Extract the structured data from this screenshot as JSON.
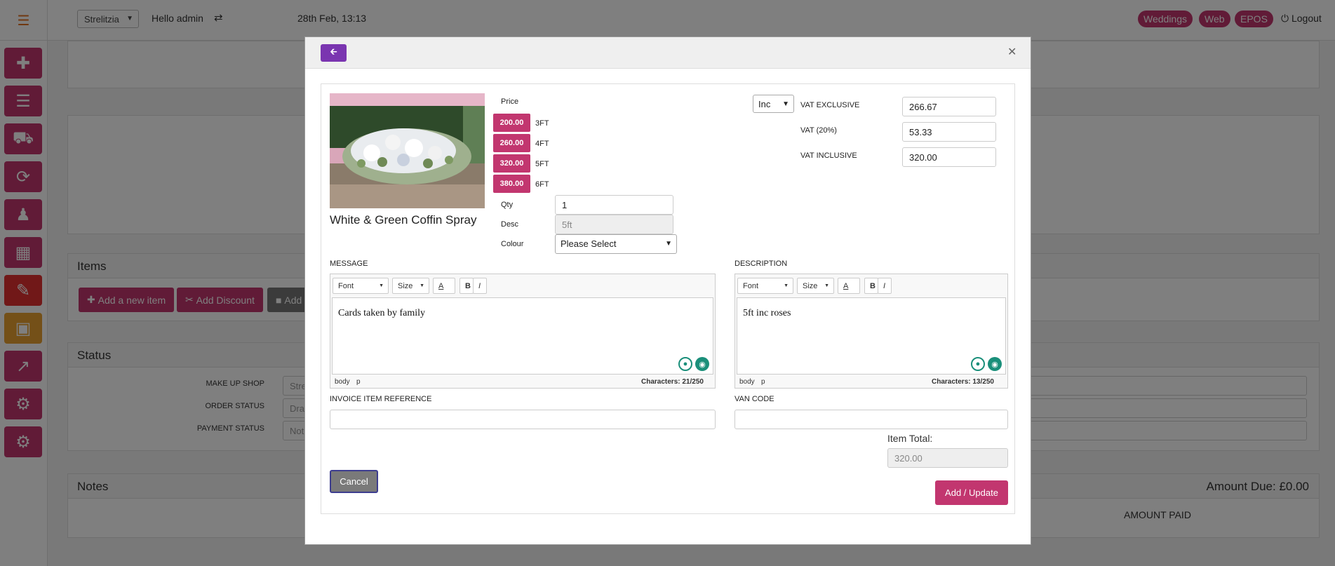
{
  "topbar": {
    "menu_icon": "hamburger-icon",
    "shop_select": "Strelitzia",
    "greeting": "Hello admin",
    "switch_icon": "shuffle-icon",
    "datetime": "28th Feb, 13:13",
    "badges": [
      "Weddings",
      "Web",
      "EPOS"
    ],
    "logout_label": "Logout",
    "logout_icon": "power-icon"
  },
  "sidebar": {
    "icons": [
      "plus-icon",
      "list-icon",
      "truck-icon",
      "refresh-icon",
      "users-icon",
      "calculator-icon",
      "edit-icon",
      "briefcase-icon",
      "external-link-icon",
      "gear-icon",
      "gear-icon"
    ]
  },
  "background": {
    "items_title": "Items",
    "add_item": "Add a new item",
    "add_discount": "Add Discount",
    "add_other": "Add",
    "status_title": "Status",
    "status_rows": [
      {
        "label": "MAKE UP SHOP",
        "value": "Stre"
      },
      {
        "label": "ORDER STATUS",
        "value": "Draf"
      },
      {
        "label": "PAYMENT STATUS",
        "value": "Not"
      }
    ],
    "notes_title": "Notes",
    "amount_due": "Amount Due: £0.00",
    "amount_paid": "AMOUNT PAID"
  },
  "modal": {
    "product_name": "White & Green Coffin Spray",
    "price_label": "Price",
    "prices": [
      {
        "value": "200.00",
        "size": "3FT"
      },
      {
        "value": "260.00",
        "size": "4FT"
      },
      {
        "value": "320.00",
        "size": "5FT"
      },
      {
        "value": "380.00",
        "size": "6FT"
      }
    ],
    "qty_label": "Qty",
    "qty": "1",
    "desc_label": "Desc",
    "desc": "5ft",
    "colour_label": "Colour",
    "colour_value": "Please Select",
    "vat_mode": "Inc",
    "vat_exclusive_label": "VAT EXCLUSIVE",
    "vat_exclusive": "266.67",
    "vat_label": "VAT (20%)",
    "vat": "53.33",
    "vat_inclusive_label": "VAT INCLUSIVE",
    "vat_inclusive": "320.00",
    "message_label": "MESSAGE",
    "message_text": "Cards taken by family",
    "message_chars": "Characters: 21/250",
    "description_label": "DESCRIPTION",
    "description_text": "5ft inc roses",
    "description_chars": "Characters: 13/250",
    "toolbar": {
      "font": "Font",
      "size": "Size",
      "color": "A",
      "bold": "B",
      "italic": "I"
    },
    "path_body": "body",
    "path_p": "p",
    "invoice_ref_label": "INVOICE ITEM REFERENCE",
    "van_code_label": "VAN CODE",
    "item_total_label": "Item Total:",
    "item_total": "320.00",
    "cancel_label": "Cancel",
    "add_update_label": "Add / Update"
  },
  "colors": {
    "brand": "#c2366f",
    "back_button": "#7a35b0",
    "grammarly": "#1a8f7a"
  }
}
